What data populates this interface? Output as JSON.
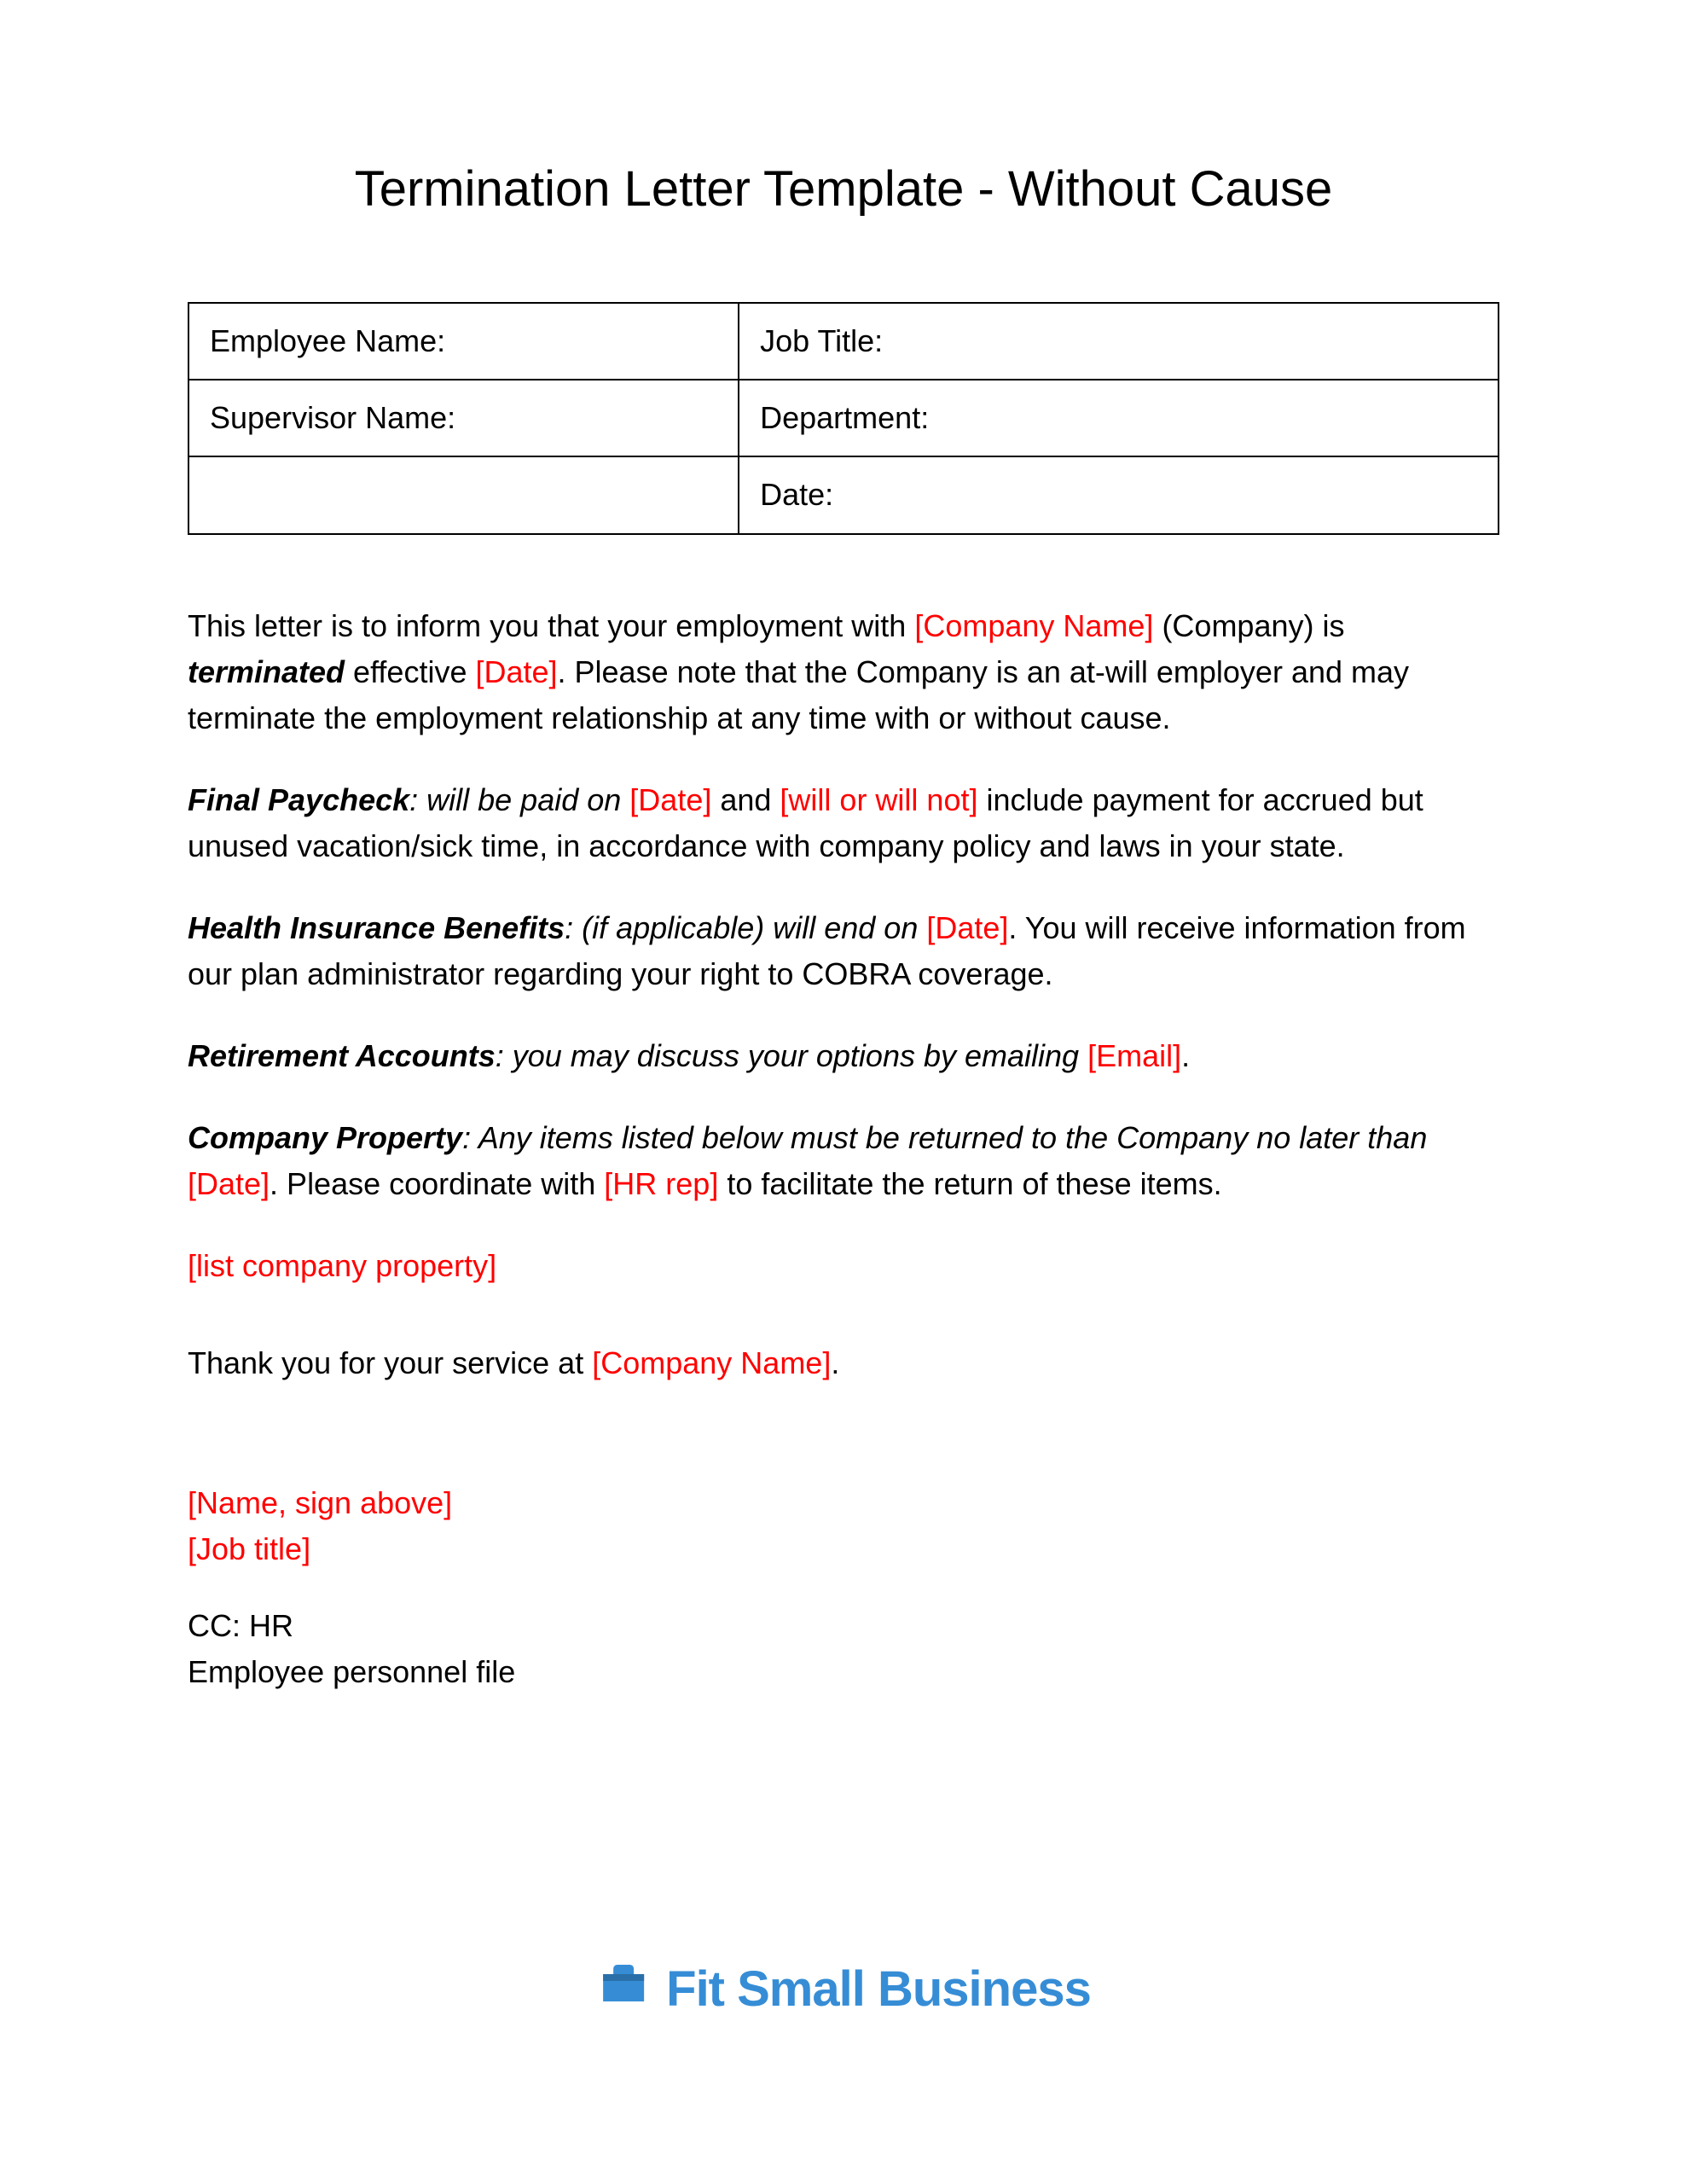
{
  "title": "Termination Letter Template - Without Cause",
  "table": {
    "r1c1": "Employee Name:",
    "r1c2": "Job Title:",
    "r2c1": "Supervisor Name:",
    "r2c2": "Department:",
    "r3c1": "",
    "r3c2": "Date:"
  },
  "intro": {
    "t1": "This letter is to inform you that your employment with ",
    "ph1": "[Company Name]",
    "t2": " (Company) is ",
    "term": "terminated",
    "t3": " effective ",
    "ph2": "[Date]",
    "t4": ". Please note that the Company is an at-will employer and may terminate the employment relationship at any time with or without cause."
  },
  "paycheck": {
    "label": "Final Paycheck",
    "t1": ": will be paid on ",
    "ph1": "[Date]",
    "t2": " and ",
    "ph2": "[will or will not]",
    "t3": " include payment for accrued but unused vacation/sick time, in accordance with company policy and laws in your state."
  },
  "health": {
    "label": "Health Insurance Benefits",
    "t1": ": (if applicable) will end on ",
    "ph1": "[Date]",
    "t2": ". You will receive information from our plan administrator regarding your right to COBRA coverage."
  },
  "retirement": {
    "label": "Retirement Accounts",
    "t1": ": you may discuss your options by emailing ",
    "ph1": "[Email]",
    "t2": "."
  },
  "property": {
    "label": "Company Property",
    "t1": ": Any items listed below must be returned to the Company no later than ",
    "ph1": "[Date]",
    "t2": ". Please coordinate with ",
    "ph2": "[HR rep]",
    "t3": " to facilitate the return of these items."
  },
  "list_property": "[list company property]",
  "thanks": {
    "t1": "Thank you for your service at ",
    "ph1": "[Company Name]",
    "t2": "."
  },
  "signature": {
    "name": "[Name, sign above]",
    "title": "[Job title]"
  },
  "cc": {
    "line1": "CC: HR",
    "line2": "Employee personnel file"
  },
  "footer": {
    "brand": "Fit Small Business"
  }
}
